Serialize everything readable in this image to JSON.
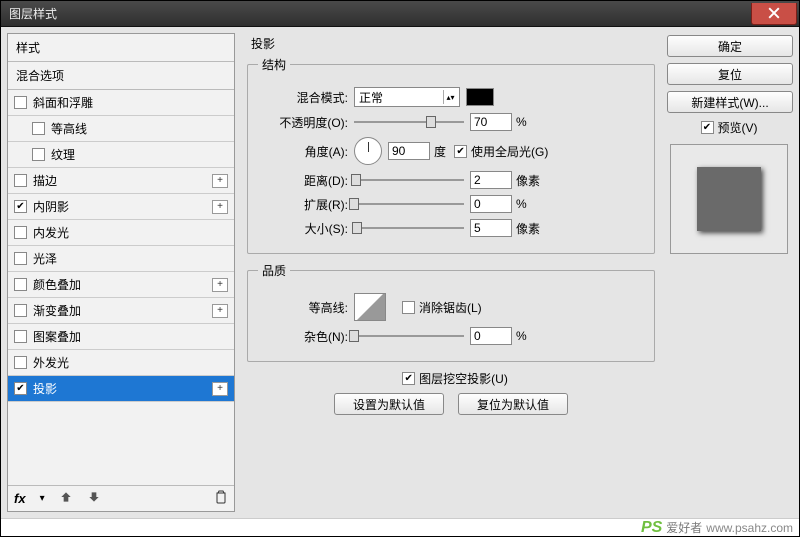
{
  "window": {
    "title": "图层样式"
  },
  "sidebar": {
    "header": "样式",
    "blend_header": "混合选项",
    "items": [
      {
        "label": "斜面和浮雕",
        "checked": false,
        "plus": false,
        "indent": false
      },
      {
        "label": "等高线",
        "checked": false,
        "plus": false,
        "indent": true
      },
      {
        "label": "纹理",
        "checked": false,
        "plus": false,
        "indent": true
      },
      {
        "label": "描边",
        "checked": false,
        "plus": true,
        "indent": false
      },
      {
        "label": "内阴影",
        "checked": true,
        "plus": true,
        "indent": false
      },
      {
        "label": "内发光",
        "checked": false,
        "plus": false,
        "indent": false
      },
      {
        "label": "光泽",
        "checked": false,
        "plus": false,
        "indent": false
      },
      {
        "label": "颜色叠加",
        "checked": false,
        "plus": true,
        "indent": false
      },
      {
        "label": "渐变叠加",
        "checked": false,
        "plus": true,
        "indent": false
      },
      {
        "label": "图案叠加",
        "checked": false,
        "plus": false,
        "indent": false
      },
      {
        "label": "外发光",
        "checked": false,
        "plus": false,
        "indent": false
      },
      {
        "label": "投影",
        "checked": true,
        "plus": true,
        "indent": false,
        "selected": true
      }
    ],
    "footer_fx": "fx"
  },
  "panel": {
    "title": "投影",
    "structure": {
      "legend": "结构",
      "blend_mode_label": "混合模式:",
      "blend_mode_value": "正常",
      "opacity_label": "不透明度(O):",
      "opacity_value": "70",
      "opacity_unit": "%",
      "angle_label": "角度(A):",
      "angle_value": "90",
      "angle_unit": "度",
      "global_light_label": "使用全局光(G)",
      "global_light_checked": true,
      "distance_label": "距离(D):",
      "distance_value": "2",
      "distance_unit": "像素",
      "spread_label": "扩展(R):",
      "spread_value": "0",
      "spread_unit": "%",
      "size_label": "大小(S):",
      "size_value": "5",
      "size_unit": "像素"
    },
    "quality": {
      "legend": "品质",
      "contour_label": "等高线:",
      "antialias_label": "消除锯齿(L)",
      "antialias_checked": false,
      "noise_label": "杂色(N):",
      "noise_value": "0",
      "noise_unit": "%"
    },
    "knockout_label": "图层挖空投影(U)",
    "knockout_checked": true,
    "set_default": "设置为默认值",
    "reset_default": "复位为默认值"
  },
  "buttons": {
    "ok": "确定",
    "cancel": "复位",
    "new_style": "新建样式(W)...",
    "preview": "预览(V)"
  },
  "watermark": {
    "ps": "PS",
    "text": "爱好者",
    "url": "www.psahz.com"
  }
}
